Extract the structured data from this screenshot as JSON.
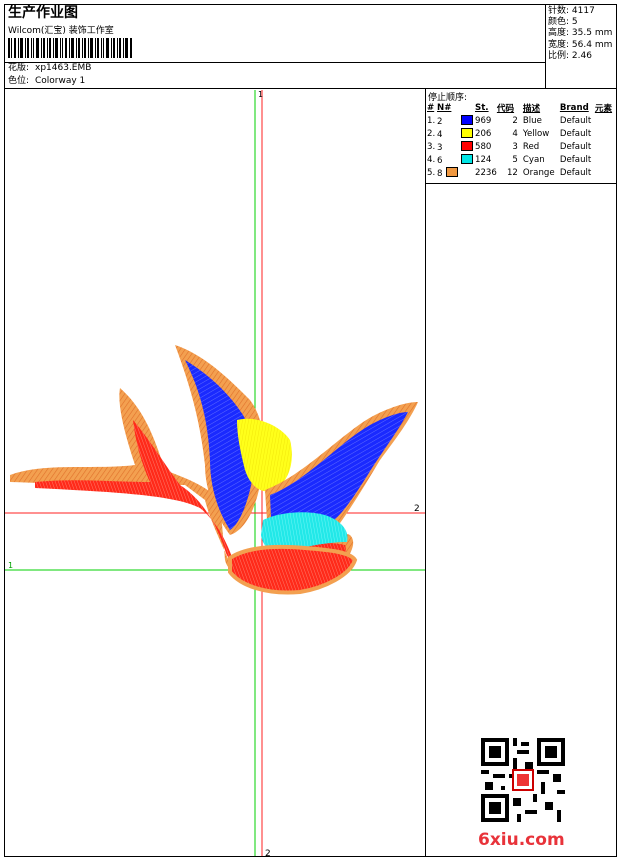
{
  "header": {
    "title": "生产作业图",
    "studio": "Wilcom(汇宝) 装饰工作室",
    "pattern_label": "花版:",
    "pattern_value": "xp1463.EMB",
    "color_label": "色位:",
    "color_value": "Colorway 1"
  },
  "stats": [
    {
      "label": "针数:",
      "value": "4117"
    },
    {
      "label": "颜色:",
      "value": "5"
    },
    {
      "label": "高度:",
      "value": "35.5 mm"
    },
    {
      "label": "宽度:",
      "value": "56.4 mm"
    },
    {
      "label": "比例:",
      "value": "2.46"
    }
  ],
  "stop_sequence": {
    "title": "停止顺序:",
    "headers": [
      "#",
      "N#",
      "St.",
      "代码",
      "描述",
      "Brand",
      "元素"
    ],
    "rows": [
      {
        "idx": "1.",
        "n": "2",
        "st": "969",
        "code": "2",
        "desc": "Blue",
        "brand": "Default",
        "color": "#0000ff"
      },
      {
        "idx": "2.",
        "n": "4",
        "st": "206",
        "code": "4",
        "desc": "Yellow",
        "brand": "Default",
        "color": "#ffff00"
      },
      {
        "idx": "3.",
        "n": "3",
        "st": "580",
        "code": "3",
        "desc": "Red",
        "brand": "Default",
        "color": "#ff0000"
      },
      {
        "idx": "4.",
        "n": "6",
        "st": "124",
        "code": "5",
        "desc": "Cyan",
        "brand": "Default",
        "color": "#00e5e5"
      },
      {
        "idx": "5.",
        "n": "8",
        "st": "2236",
        "code": "12",
        "desc": "Orange",
        "brand": "Default",
        "color": "#f09840"
      }
    ]
  },
  "markers": {
    "top_v": "1",
    "bottom_v": "2",
    "left_h": "1",
    "right_h": "2"
  },
  "watermark": "6xiu.com"
}
